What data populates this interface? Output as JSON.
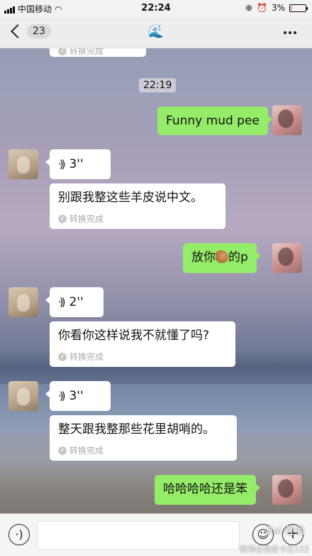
{
  "status_bar": {
    "carrier": "中国移动",
    "time": "22:24",
    "battery": "3%",
    "battery_level": 0.03
  },
  "nav": {
    "unread_count": "23",
    "title_icon": "wave-emoji"
  },
  "chat": {
    "top_partial_done": "转换完成",
    "time_label": "22:19",
    "messages": [
      {
        "side": "me",
        "text": "Funny mud pee"
      },
      {
        "side": "theirs",
        "voice_duration": "3''",
        "transcript": "别跟我整这些羊皮说中文。",
        "status": "转换完成"
      },
      {
        "side": "me",
        "text_before": "放你",
        "emoji": "horse-emoji",
        "text_after": "的p"
      },
      {
        "side": "theirs",
        "voice_duration": "2''",
        "transcript": "你看你这样说我不就懂了吗?",
        "status": "转换完成"
      },
      {
        "side": "theirs",
        "voice_duration": "3''",
        "transcript": "整天跟我整那些花里胡哨的。",
        "status": "转换完成"
      },
      {
        "side": "me",
        "text": "哈哈哈哈还是笨"
      }
    ]
  },
  "input_bar": {
    "voice_icon": "voice-icon",
    "emoji_icon": "smile-icon",
    "plus_icon": "plus-icon"
  },
  "watermark": {
    "main": "Bai 经验",
    "sub": "微博@是皮卡丘122"
  },
  "colors": {
    "my_bubble": "#95ec69",
    "their_bubble": "#ffffff",
    "nav_bg": "#ededed"
  }
}
